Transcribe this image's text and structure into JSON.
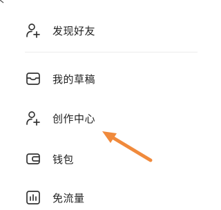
{
  "menu": {
    "items": [
      {
        "label": "发现好友",
        "icon": "add-person-icon"
      },
      {
        "label": "我的草稿",
        "icon": "draft-tray-icon"
      },
      {
        "label": "创作中心",
        "icon": "creator-person-icon"
      },
      {
        "label": "钱包",
        "icon": "wallet-icon"
      },
      {
        "label": "免流量",
        "icon": "data-free-icon"
      }
    ]
  },
  "annotation": {
    "arrow_color": "#f08a3c"
  },
  "colors": {
    "text": "#222222",
    "icon": "#333333",
    "divider": "#ececec"
  }
}
